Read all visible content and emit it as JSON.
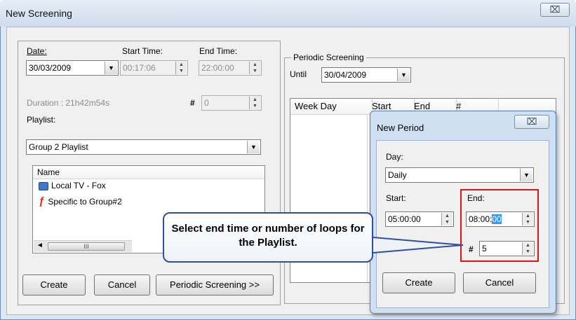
{
  "window": {
    "title": "New Screening",
    "close_glyph": "⌧"
  },
  "schedule": {
    "date_label": "Date:",
    "date_value": "30/03/2009",
    "start_time_label": "Start Time:",
    "start_time_value": "00:17:06",
    "end_time_label": "End Time:",
    "end_time_value": "22:00:00",
    "duration_text": "Duration : 21h42m54s",
    "loops_label": "#",
    "loops_value": "0"
  },
  "playlist": {
    "label": "Playlist:",
    "selected": "Group 2 Playlist",
    "column_name": "Name",
    "items": [
      {
        "name": "Local TV - Fox",
        "icon": "monitor-icon"
      },
      {
        "name": "Specific to Group#2",
        "icon": "flash-icon"
      }
    ],
    "scroll_thumb": "III"
  },
  "buttons": {
    "create": "Create",
    "cancel": "Cancel",
    "periodic": "Periodic Screening >>"
  },
  "periodic": {
    "group_label": "Periodic Screening",
    "until_label": "Until",
    "until_value": "30/04/2009",
    "columns": [
      "Week Day",
      "Start",
      "End",
      "#"
    ]
  },
  "new_period": {
    "title": "New Period",
    "close_glyph": "⌧",
    "day_label": "Day:",
    "day_value": "Daily",
    "start_label": "Start:",
    "start_value": "05:00:00",
    "end_label": "End:",
    "end_value_main": "08:00:",
    "end_value_selected": "00",
    "loops_label": "#",
    "loops_value": "5",
    "create": "Create",
    "cancel": "Cancel"
  },
  "callout": {
    "text": "Select end time or number of loops for the Playlist."
  },
  "colors": {
    "highlight": "#e01414",
    "callout_border": "#2f4fa0",
    "selection": "#3399ff"
  }
}
